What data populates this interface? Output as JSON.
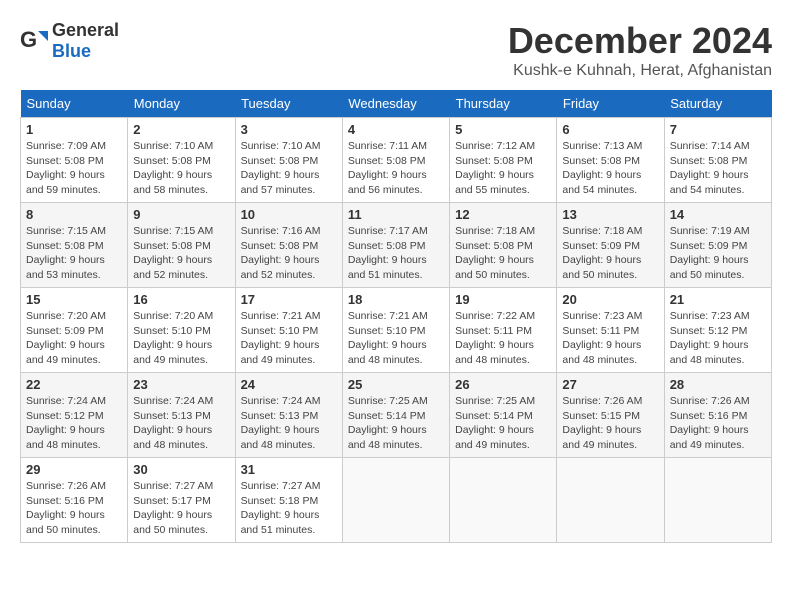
{
  "header": {
    "logo_general": "General",
    "logo_blue": "Blue",
    "month_title": "December 2024",
    "location": "Kushk-e Kuhnah, Herat, Afghanistan"
  },
  "days_of_week": [
    "Sunday",
    "Monday",
    "Tuesday",
    "Wednesday",
    "Thursday",
    "Friday",
    "Saturday"
  ],
  "weeks": [
    [
      {
        "day": "1",
        "sunrise": "Sunrise: 7:09 AM",
        "sunset": "Sunset: 5:08 PM",
        "daylight": "Daylight: 9 hours and 59 minutes."
      },
      {
        "day": "2",
        "sunrise": "Sunrise: 7:10 AM",
        "sunset": "Sunset: 5:08 PM",
        "daylight": "Daylight: 9 hours and 58 minutes."
      },
      {
        "day": "3",
        "sunrise": "Sunrise: 7:10 AM",
        "sunset": "Sunset: 5:08 PM",
        "daylight": "Daylight: 9 hours and 57 minutes."
      },
      {
        "day": "4",
        "sunrise": "Sunrise: 7:11 AM",
        "sunset": "Sunset: 5:08 PM",
        "daylight": "Daylight: 9 hours and 56 minutes."
      },
      {
        "day": "5",
        "sunrise": "Sunrise: 7:12 AM",
        "sunset": "Sunset: 5:08 PM",
        "daylight": "Daylight: 9 hours and 55 minutes."
      },
      {
        "day": "6",
        "sunrise": "Sunrise: 7:13 AM",
        "sunset": "Sunset: 5:08 PM",
        "daylight": "Daylight: 9 hours and 54 minutes."
      },
      {
        "day": "7",
        "sunrise": "Sunrise: 7:14 AM",
        "sunset": "Sunset: 5:08 PM",
        "daylight": "Daylight: 9 hours and 54 minutes."
      }
    ],
    [
      {
        "day": "8",
        "sunrise": "Sunrise: 7:15 AM",
        "sunset": "Sunset: 5:08 PM",
        "daylight": "Daylight: 9 hours and 53 minutes."
      },
      {
        "day": "9",
        "sunrise": "Sunrise: 7:15 AM",
        "sunset": "Sunset: 5:08 PM",
        "daylight": "Daylight: 9 hours and 52 minutes."
      },
      {
        "day": "10",
        "sunrise": "Sunrise: 7:16 AM",
        "sunset": "Sunset: 5:08 PM",
        "daylight": "Daylight: 9 hours and 52 minutes."
      },
      {
        "day": "11",
        "sunrise": "Sunrise: 7:17 AM",
        "sunset": "Sunset: 5:08 PM",
        "daylight": "Daylight: 9 hours and 51 minutes."
      },
      {
        "day": "12",
        "sunrise": "Sunrise: 7:18 AM",
        "sunset": "Sunset: 5:08 PM",
        "daylight": "Daylight: 9 hours and 50 minutes."
      },
      {
        "day": "13",
        "sunrise": "Sunrise: 7:18 AM",
        "sunset": "Sunset: 5:09 PM",
        "daylight": "Daylight: 9 hours and 50 minutes."
      },
      {
        "day": "14",
        "sunrise": "Sunrise: 7:19 AM",
        "sunset": "Sunset: 5:09 PM",
        "daylight": "Daylight: 9 hours and 50 minutes."
      }
    ],
    [
      {
        "day": "15",
        "sunrise": "Sunrise: 7:20 AM",
        "sunset": "Sunset: 5:09 PM",
        "daylight": "Daylight: 9 hours and 49 minutes."
      },
      {
        "day": "16",
        "sunrise": "Sunrise: 7:20 AM",
        "sunset": "Sunset: 5:10 PM",
        "daylight": "Daylight: 9 hours and 49 minutes."
      },
      {
        "day": "17",
        "sunrise": "Sunrise: 7:21 AM",
        "sunset": "Sunset: 5:10 PM",
        "daylight": "Daylight: 9 hours and 49 minutes."
      },
      {
        "day": "18",
        "sunrise": "Sunrise: 7:21 AM",
        "sunset": "Sunset: 5:10 PM",
        "daylight": "Daylight: 9 hours and 48 minutes."
      },
      {
        "day": "19",
        "sunrise": "Sunrise: 7:22 AM",
        "sunset": "Sunset: 5:11 PM",
        "daylight": "Daylight: 9 hours and 48 minutes."
      },
      {
        "day": "20",
        "sunrise": "Sunrise: 7:23 AM",
        "sunset": "Sunset: 5:11 PM",
        "daylight": "Daylight: 9 hours and 48 minutes."
      },
      {
        "day": "21",
        "sunrise": "Sunrise: 7:23 AM",
        "sunset": "Sunset: 5:12 PM",
        "daylight": "Daylight: 9 hours and 48 minutes."
      }
    ],
    [
      {
        "day": "22",
        "sunrise": "Sunrise: 7:24 AM",
        "sunset": "Sunset: 5:12 PM",
        "daylight": "Daylight: 9 hours and 48 minutes."
      },
      {
        "day": "23",
        "sunrise": "Sunrise: 7:24 AM",
        "sunset": "Sunset: 5:13 PM",
        "daylight": "Daylight: 9 hours and 48 minutes."
      },
      {
        "day": "24",
        "sunrise": "Sunrise: 7:24 AM",
        "sunset": "Sunset: 5:13 PM",
        "daylight": "Daylight: 9 hours and 48 minutes."
      },
      {
        "day": "25",
        "sunrise": "Sunrise: 7:25 AM",
        "sunset": "Sunset: 5:14 PM",
        "daylight": "Daylight: 9 hours and 48 minutes."
      },
      {
        "day": "26",
        "sunrise": "Sunrise: 7:25 AM",
        "sunset": "Sunset: 5:14 PM",
        "daylight": "Daylight: 9 hours and 49 minutes."
      },
      {
        "day": "27",
        "sunrise": "Sunrise: 7:26 AM",
        "sunset": "Sunset: 5:15 PM",
        "daylight": "Daylight: 9 hours and 49 minutes."
      },
      {
        "day": "28",
        "sunrise": "Sunrise: 7:26 AM",
        "sunset": "Sunset: 5:16 PM",
        "daylight": "Daylight: 9 hours and 49 minutes."
      }
    ],
    [
      {
        "day": "29",
        "sunrise": "Sunrise: 7:26 AM",
        "sunset": "Sunset: 5:16 PM",
        "daylight": "Daylight: 9 hours and 50 minutes."
      },
      {
        "day": "30",
        "sunrise": "Sunrise: 7:27 AM",
        "sunset": "Sunset: 5:17 PM",
        "daylight": "Daylight: 9 hours and 50 minutes."
      },
      {
        "day": "31",
        "sunrise": "Sunrise: 7:27 AM",
        "sunset": "Sunset: 5:18 PM",
        "daylight": "Daylight: 9 hours and 51 minutes."
      },
      null,
      null,
      null,
      null
    ]
  ]
}
